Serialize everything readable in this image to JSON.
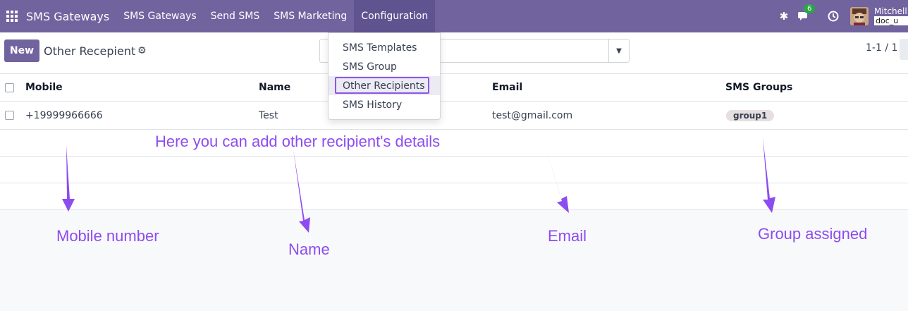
{
  "navbar": {
    "brand": "SMS Gateways",
    "menu": [
      "SMS Gateways",
      "Send SMS",
      "SMS Marketing",
      "Configuration"
    ],
    "active_menu": "Configuration",
    "chat_badge": "6",
    "user_name": "Mitchell",
    "user_db": "doc_u"
  },
  "control_panel": {
    "new_label": "New",
    "title": "Other Recepient",
    "pager": "1-1 / 1"
  },
  "dropdown": {
    "items": [
      "SMS Templates",
      "SMS Group",
      "Other Recipients",
      "SMS History"
    ],
    "selected": "Other Recipients"
  },
  "table": {
    "columns": [
      "Mobile",
      "Name",
      "Email",
      "SMS Groups"
    ],
    "rows": [
      {
        "mobile": "+19999966666",
        "name": "Test",
        "email": "test@gmail.com",
        "group": "group1"
      }
    ]
  },
  "annotations": {
    "heading": "Here you can add other recipient's details",
    "mobile": "Mobile number",
    "name": "Name",
    "email": "Email",
    "group": "Group assigned"
  },
  "colors": {
    "navbar": "#71639e",
    "annotation": "#8d4cf0",
    "highlight": "#8d55e8"
  }
}
